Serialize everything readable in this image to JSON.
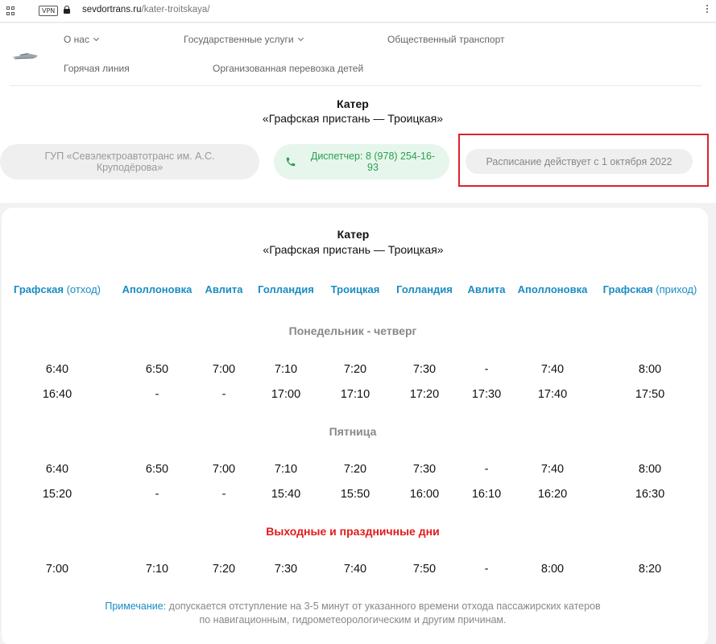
{
  "browser": {
    "vpn_label": "VPN",
    "url_host": "sevdortrans.ru",
    "url_path": "/kater-troitskaya/"
  },
  "nav": {
    "about": "О нас",
    "gov_services": "Государственные услуги",
    "public_transport": "Общественный транспорт",
    "hotline": "Горячая линия",
    "children_transport": "Организованная перевозка детей"
  },
  "header": {
    "title": "Катер",
    "subtitle": "«Графская пристань — Троицкая»"
  },
  "info": {
    "organization": "ГУП «Севэлектроавтотранс им. А.С. Круподёрова»",
    "dispatcher": "Диспетчер: 8 (978) 254-16-93",
    "schedule_notice": "Расписание действует с 1 октября 2022"
  },
  "card": {
    "title": "Катер",
    "subtitle": "«Графская пристань — Троицкая»"
  },
  "columns": [
    {
      "name": "Графская",
      "sub": " (отход)"
    },
    {
      "name": "Аполлоновка",
      "sub": ""
    },
    {
      "name": "Авлита",
      "sub": ""
    },
    {
      "name": "Голландия",
      "sub": ""
    },
    {
      "name": "Троицкая",
      "sub": ""
    },
    {
      "name": "Голландия",
      "sub": ""
    },
    {
      "name": "Авлита",
      "sub": ""
    },
    {
      "name": "Аполлоновка",
      "sub": ""
    },
    {
      "name": "Графская",
      "sub": " (приход)"
    }
  ],
  "sections": [
    {
      "title": "Понедельник - четверг",
      "style": "grey",
      "rows": [
        [
          "6:40",
          "6:50",
          "7:00",
          "7:10",
          "7:20",
          "7:30",
          "-",
          "7:40",
          "8:00"
        ],
        [
          "16:40",
          "-",
          "-",
          "17:00",
          "17:10",
          "17:20",
          "17:30",
          "17:40",
          "17:50"
        ]
      ]
    },
    {
      "title": "Пятница",
      "style": "grey",
      "rows": [
        [
          "6:40",
          "6:50",
          "7:00",
          "7:10",
          "7:20",
          "7:30",
          "-",
          "7:40",
          "8:00"
        ],
        [
          "15:20",
          "-",
          "-",
          "15:40",
          "15:50",
          "16:00",
          "16:10",
          "16:20",
          "16:30"
        ]
      ]
    },
    {
      "title": "Выходные и праздничные дни",
      "style": "red",
      "rows": [
        [
          "7:00",
          "7:10",
          "7:20",
          "7:30",
          "7:40",
          "7:50",
          "-",
          "8:00",
          "8:20"
        ]
      ]
    }
  ],
  "note": {
    "label": "Примечание:",
    "line1": " допускается отступление на 3-5 минут от указанного времени отхода пассажирских катеров",
    "line2": "по навигационным, гидрометеорологическим и другим причинам."
  },
  "colors": {
    "accent_blue": "#1a8cc2",
    "phone_green": "#2aa04e",
    "weekend_red": "#e11b1b",
    "highlight_frame": "#d9232e"
  },
  "icons": {
    "apps": "grid-icon",
    "lock": "lock-icon",
    "menu": "more-vert-icon",
    "phone": "phone-icon",
    "logo": "boat-logo-icon"
  }
}
